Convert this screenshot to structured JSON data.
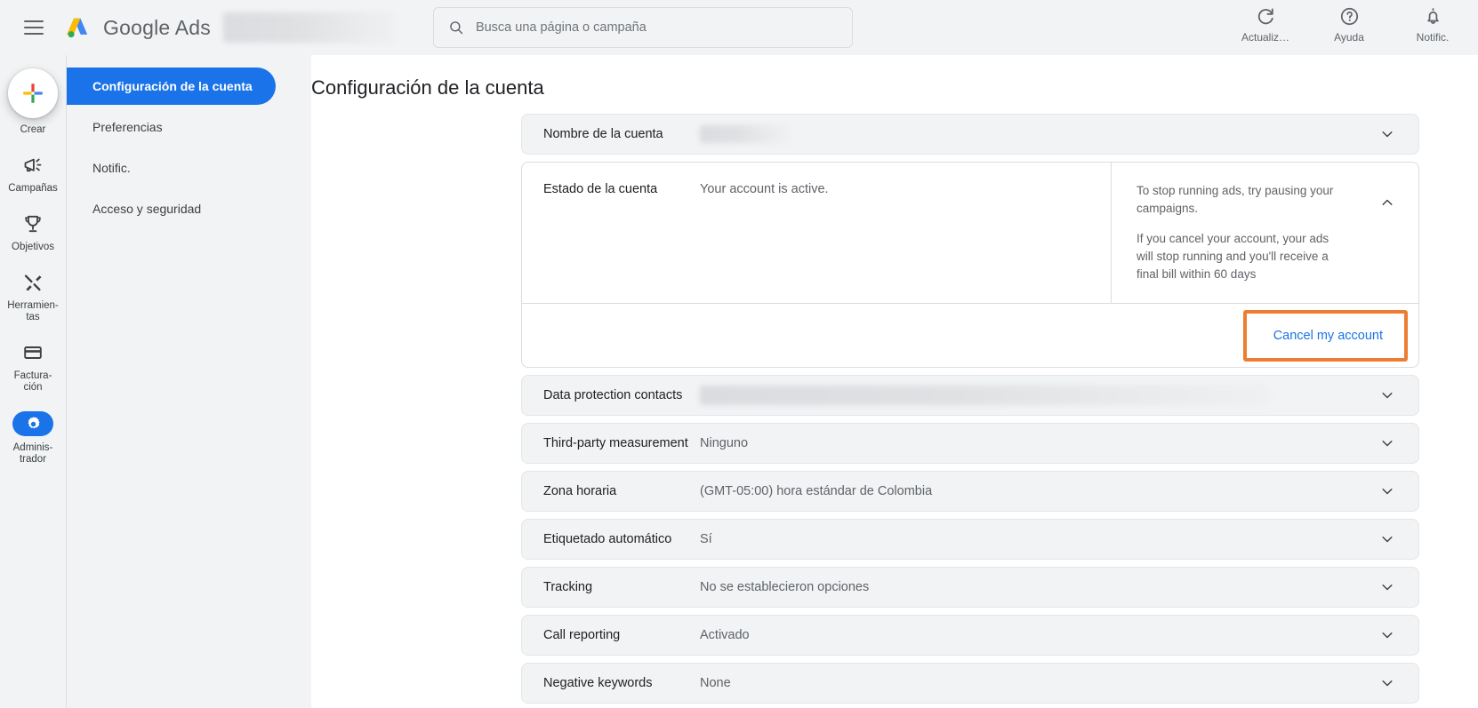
{
  "header": {
    "menu_icon": "hamburger-icon",
    "brand": "Google Ads",
    "brand_google": "Google",
    "brand_ads": "Ads",
    "account_redacted": "",
    "search": {
      "placeholder": "Busca una página o campaña",
      "value": "",
      "icon": "search-icon"
    },
    "actions": [
      {
        "id": "refresh",
        "label": "Actualiz…",
        "icon": "refresh-icon"
      },
      {
        "id": "help",
        "label": "Ayuda",
        "icon": "help-circle-icon"
      },
      {
        "id": "notifications",
        "label": "Notific.",
        "icon": "bell-icon"
      }
    ]
  },
  "rail": {
    "create": {
      "label": "Crear",
      "icon": "plus-icon"
    },
    "items": [
      {
        "id": "campaigns",
        "label": "Campañas",
        "icon": "megaphone-icon",
        "active": false
      },
      {
        "id": "goals",
        "label": "Objetivos",
        "icon": "trophy-icon",
        "active": false
      },
      {
        "id": "tools",
        "label": "Herramien-\ntas",
        "label_line1": "Herramien-",
        "label_line2": "tas",
        "icon": "tools-icon",
        "active": false
      },
      {
        "id": "billing",
        "label": "Factura-\nción",
        "label_line1": "Factura-",
        "label_line2": "ción",
        "icon": "credit-card-icon",
        "active": false
      },
      {
        "id": "admin",
        "label": "Adminis-\ntrador",
        "label_line1": "Adminis-",
        "label_line2": "trador",
        "icon": "gear-icon",
        "active": true
      }
    ]
  },
  "subnav": {
    "items": [
      {
        "id": "account-settings",
        "label": "Configuración de la cuenta",
        "selected": true
      },
      {
        "id": "preferences",
        "label": "Preferencias",
        "selected": false
      },
      {
        "id": "notifications",
        "label": "Notific.",
        "selected": false
      },
      {
        "id": "access-security",
        "label": "Acceso y seguridad",
        "selected": false
      }
    ]
  },
  "main": {
    "page_title": "Configuración de la cuenta",
    "account_name_card": {
      "label": "Nombre de la cuenta",
      "value_redacted": true,
      "chevron": "chevron-down-icon"
    },
    "account_status_card": {
      "label": "Estado de la cuenta",
      "value": "Your account is active.",
      "chevron": "chevron-up-icon",
      "notes": [
        "To stop running ads, try pausing your campaigns.",
        "If you cancel your account, your ads will stop running and you'll receive a final bill within 60 days"
      ],
      "cancel_link": "Cancel my account",
      "highlight_color": "#ed7d31"
    },
    "rows": [
      {
        "id": "data-protection-contacts",
        "label": "Data protection contacts",
        "value": "",
        "redacted": true,
        "chevron": "chevron-down-icon"
      },
      {
        "id": "third-party-measurement",
        "label": "Third-party measurement",
        "value": "Ninguno",
        "redacted": false,
        "chevron": "chevron-down-icon"
      },
      {
        "id": "time-zone",
        "label": "Zona horaria",
        "value": "(GMT-05:00) hora estándar de Colombia",
        "redacted": false,
        "chevron": "chevron-down-icon"
      },
      {
        "id": "auto-tagging",
        "label": "Etiquetado automático",
        "value": "Sí",
        "redacted": false,
        "chevron": "chevron-down-icon"
      },
      {
        "id": "tracking",
        "label": "Tracking",
        "value": "No se establecieron opciones",
        "redacted": false,
        "chevron": "chevron-down-icon"
      },
      {
        "id": "call-reporting",
        "label": "Call reporting",
        "value": "Activado",
        "redacted": false,
        "chevron": "chevron-down-icon"
      },
      {
        "id": "negative-keywords",
        "label": "Negative keywords",
        "value": "None",
        "redacted": false,
        "chevron": "chevron-down-icon"
      }
    ]
  },
  "colors": {
    "accent": "#1a73e8",
    "link": "#1a73e8",
    "highlight": "#ed7d31",
    "page_bg": "#f1f3f4",
    "card_bg": "#ffffff"
  }
}
